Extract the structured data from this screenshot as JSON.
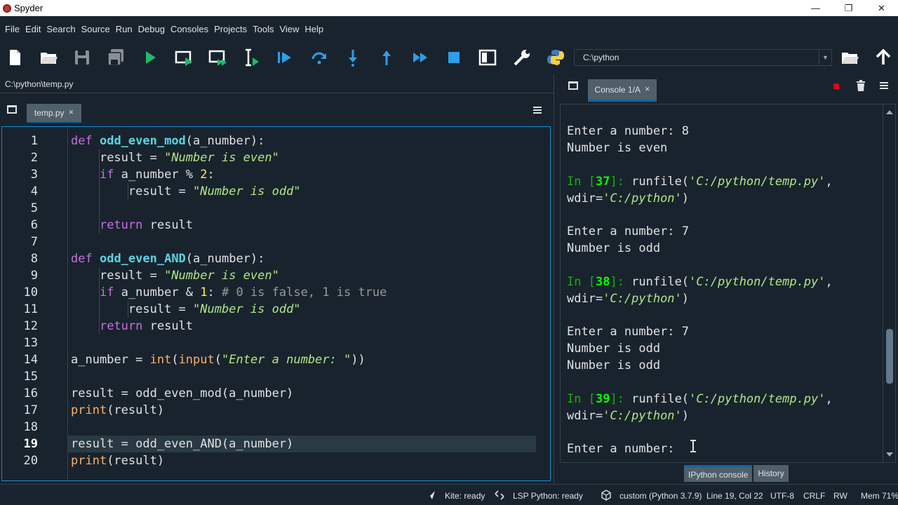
{
  "window": {
    "title": "Spyder"
  },
  "menu": [
    "File",
    "Edit",
    "Search",
    "Source",
    "Run",
    "Debug",
    "Consoles",
    "Projects",
    "Tools",
    "View",
    "Help"
  ],
  "toolbar": {
    "working_dir": "C:\\python",
    "icons": [
      "new-file-icon",
      "open-file-icon",
      "save-icon",
      "save-all-icon",
      "run-icon",
      "run-cell-icon",
      "run-cell-advance-icon",
      "run-selection-icon",
      "debug-icon",
      "step-icon",
      "step-into-icon",
      "step-return-icon",
      "continue-icon",
      "stop-icon",
      "maximize-pane-icon",
      "preferences-icon",
      "python-path-icon"
    ]
  },
  "editor": {
    "file_path": "C:\\python\\temp.py",
    "tab_label": "temp.py",
    "current_line": 19,
    "line_numbers": [
      "1",
      "2",
      "3",
      "4",
      "5",
      "6",
      "7",
      "8",
      "9",
      "10",
      "11",
      "12",
      "13",
      "14",
      "15",
      "16",
      "17",
      "18",
      "19",
      "20"
    ],
    "colors": {
      "keyword": "#c670e0",
      "function": "#57d6e4",
      "string": "#b0e686",
      "number": "#faed5c",
      "comment": "#999999",
      "builtin": "#fab16c"
    }
  },
  "code": {
    "l1": {
      "kw": "def",
      "fn": "odd_even_mod",
      "rest": "(a_number):"
    },
    "l2": {
      "a": "result = ",
      "s": "\"Number is even\""
    },
    "l3": {
      "kw": "if",
      "a": " a_number % ",
      "n": "2",
      "b": ":"
    },
    "l4": {
      "a": "result = ",
      "s": "\"Number is odd\""
    },
    "l6": {
      "kw": "return",
      "a": " result"
    },
    "l8": {
      "kw": "def",
      "fn": "odd_even_AND",
      "rest": "(a_number):"
    },
    "l9": {
      "a": "result = ",
      "s": "\"Number is even\""
    },
    "l10": {
      "kw": "if",
      "a": " a_number & ",
      "n": "1",
      "b": ": ",
      "c": "# 0 is false, 1 is true"
    },
    "l11": {
      "a": "result = ",
      "s": "\"Number is odd\""
    },
    "l12": {
      "kw": "return",
      "a": " result"
    },
    "l14": {
      "a": "a_number = ",
      "b1": "int",
      "p1": "(",
      "b2": "input",
      "p2": "(",
      "s": "\"Enter a number: \"",
      "p3": "))"
    },
    "l16": {
      "a": "result = odd_even_mod(a_number)"
    },
    "l17": {
      "b": "print",
      "a": "(result)"
    },
    "l19": {
      "a": "result = odd_even_AND(a_number)"
    },
    "l20": {
      "b": "print",
      "a": "(result)"
    }
  },
  "console": {
    "tab_label": "Console 1/A",
    "lines": {
      "c1": "Enter a number: 8",
      "c2": "Number is even",
      "p37": {
        "pre": "In [",
        "num": "37",
        "post": "]: ",
        "call": "runfile(",
        "arg": "'C:/python/temp.py'",
        "end": ","
      },
      "w37": {
        "pre": "wdir=",
        "arg": "'C:/python'",
        "end": ")"
      },
      "c3": "Enter a number: 7",
      "c4": "Number is odd",
      "p38": {
        "pre": "In [",
        "num": "38",
        "post": "]: ",
        "call": "runfile(",
        "arg": "'C:/python/temp.py'",
        "end": ","
      },
      "w38": {
        "pre": "wdir=",
        "arg": "'C:/python'",
        "end": ")"
      },
      "c5": "Enter a number: 7",
      "c6": "Number is odd",
      "c7": "Number is odd",
      "p39": {
        "pre": "In [",
        "num": "39",
        "post": "]: ",
        "call": "runfile(",
        "arg": "'C:/python/temp.py'",
        "end": ","
      },
      "w39": {
        "pre": "wdir=",
        "arg": "'C:/python'",
        "end": ")"
      },
      "c8": "Enter a number: "
    },
    "bottom_tabs": [
      "IPython console",
      "History"
    ]
  },
  "statusbar": {
    "kite": "Kite: ready",
    "lsp": "LSP Python: ready",
    "env": "custom (Python 3.7.9)",
    "position": "Line 19, Col 22",
    "encoding": "UTF-8",
    "eol": "CRLF",
    "rw": "RW",
    "mem": "Mem 71%"
  }
}
